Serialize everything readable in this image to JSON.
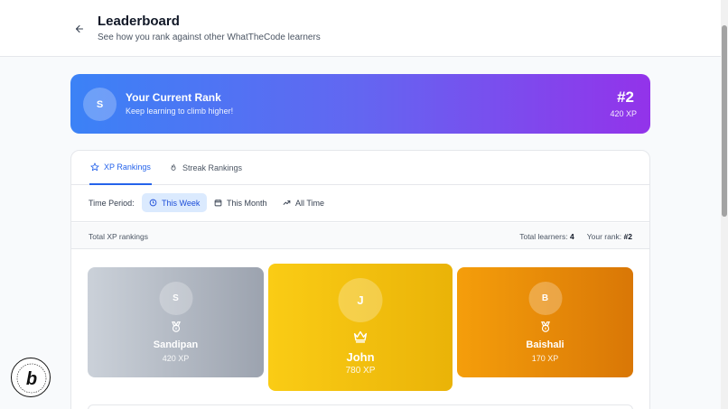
{
  "header": {
    "title": "Leaderboard",
    "subtitle": "See how you rank against other WhatTheCode learners"
  },
  "current_rank": {
    "avatar_initial": "S",
    "title": "Your Current Rank",
    "subtitle": "Keep learning to climb higher!",
    "rank": "#2",
    "xp": "420 XP"
  },
  "tabs": [
    {
      "label": "XP Rankings",
      "icon": "star-icon",
      "active": true
    },
    {
      "label": "Streak Rankings",
      "icon": "flame-icon",
      "active": false
    }
  ],
  "period": {
    "label": "Time Period:",
    "options": [
      {
        "label": "This Week",
        "icon": "clock-icon",
        "active": true
      },
      {
        "label": "This Month",
        "icon": "calendar-icon",
        "active": false
      },
      {
        "label": "All Time",
        "icon": "trending-up-icon",
        "active": false
      }
    ]
  },
  "summary": {
    "left": "Total XP rankings",
    "total_label": "Total learners:",
    "total_value": "4",
    "rank_label": "Your rank:",
    "rank_value": "#2"
  },
  "podium": {
    "first": {
      "initial": "J",
      "name": "John",
      "xp": "780 XP",
      "icon": "crown-icon"
    },
    "second": {
      "initial": "S",
      "name": "Sandipan",
      "xp": "420 XP",
      "icon": "medal-icon"
    },
    "third": {
      "initial": "B",
      "name": "Baishali",
      "xp": "170 XP",
      "icon": "medal-icon"
    }
  },
  "colors": {
    "accent": "#2563eb",
    "banner_start": "#3b82f6",
    "banner_end": "#9333ea",
    "gold": "#eab308",
    "silver": "#9ca3af",
    "bronze": "#d97706"
  }
}
